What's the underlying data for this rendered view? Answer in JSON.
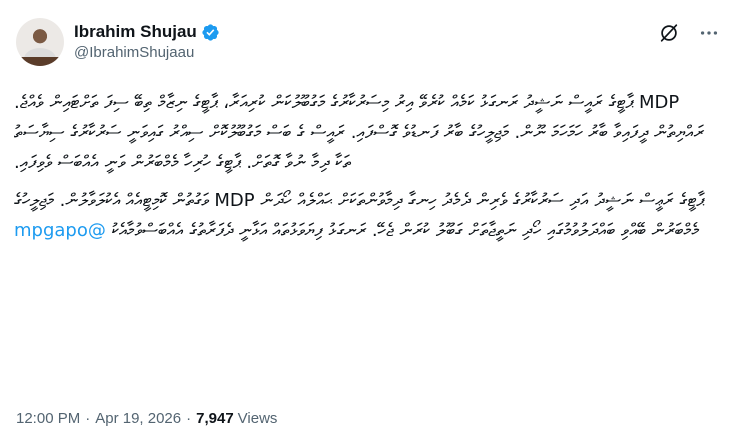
{
  "author": {
    "display_name": "Ibrahim Shujau",
    "handle": "@IbrahimShujaau",
    "verified": true,
    "accent_color": "#1d9bf0"
  },
  "icons": {
    "grok": "grok-icon",
    "more": "more-icon",
    "verified": "verified-badge-icon"
  },
  "tweet": {
    "paragraph1": "MDP ޕާޓީގެ ރައީސް ނަޝީދު ރަނގަޅު ކަމެއް ކުރެވޭ އިރު މިސަރުކާރުގެ މަގުބޫލުކަން ކުރިއަރާ، ޕާޓީގެ ނިޒާމް ތިބޭ ސިފަ ތަށްޓައިން ވެއްޖެ. ރައްޔިތުން ދީފައިވާ ބާރު ހަމަހަމަ ނޫން. މަޖިލީހުގެ ބާރު ފަނޑުވެ ގޮސްފައި. ރައީސް ގެ ބަސް މަގުބޫލުކޮށް ސިއްރު ގައިވަނީ ސަރުކާރުގެ ސިޔާސަތު ތަކާ ދިމާ ނުވާ ގޮތަށް. ޕާޓީގެ ހުރިހާ މެމްބަރުން ވަނީ އެއްބަސް ވެވިފައި.",
    "paragraph2_pre": "ޕާޓީގެ ރަޢީސް ނަޝީދު އަދި ސަރުކާރުގެ ވެރިން ދެމެދު ހިނގާ ދިމާވުންތަކަށް ޙައްލެއް ހޯދަން MDP ވަގުތުން ކޮމިޓީއެއް އެކުލަވާލުން. މަޖިލީހުގެ މެމްބަރުން ބޭއްވި ބައްދަލުވުމުގައި ހޯދި ނަތީޖާތަށް ގަބޫލު ކުރަން ޖެހޭ. ރަނގަޅު ފިޔަވަޅުތައް އަޅާނީ ދެފަރާތުގެ އެއްބަސްވުމާއެކު ",
    "mention": "@mpgapo"
  },
  "meta": {
    "time": "12:00 PM",
    "separator": "·",
    "date": "Apr 19, 2026",
    "views_count": "7,947",
    "views_label": "Views"
  }
}
